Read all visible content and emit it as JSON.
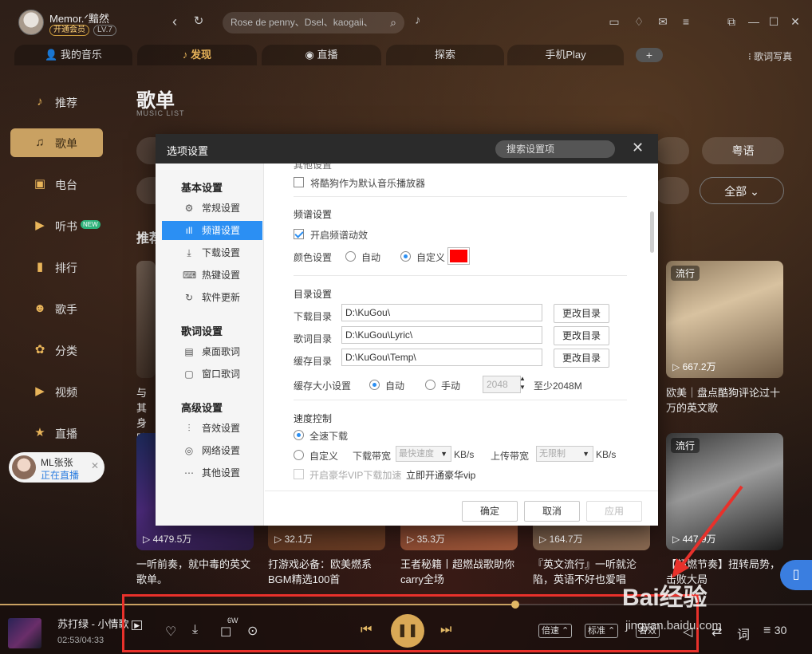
{
  "user": {
    "name": "Memor.ᐟ黯然",
    "vip": "开通会员",
    "level": "LV.7"
  },
  "search": {
    "placeholder": "Rose de penny、Dsel、kaogaii、"
  },
  "tabs": [
    {
      "label": "我的音乐"
    },
    {
      "label": "发现"
    },
    {
      "label": "直播"
    },
    {
      "label": "探索"
    },
    {
      "label": "手机Play"
    }
  ],
  "lyric_wallpaper": "歌词写真",
  "sidebar": {
    "items": [
      {
        "label": "推荐",
        "icon": "music-note-icon"
      },
      {
        "label": "歌单",
        "icon": "playlist-icon"
      },
      {
        "label": "电台",
        "icon": "radio-icon"
      },
      {
        "label": "听书",
        "icon": "book-icon",
        "badge": "NEW"
      },
      {
        "label": "排行",
        "icon": "chart-icon"
      },
      {
        "label": "歌手",
        "icon": "singer-icon"
      },
      {
        "label": "分类",
        "icon": "category-icon"
      },
      {
        "label": "视频",
        "icon": "video-icon"
      },
      {
        "label": "直播",
        "icon": "live-icon"
      }
    ],
    "live_card": {
      "name": "ML张张",
      "status": "正在直播"
    }
  },
  "page": {
    "title": "歌单",
    "subtitle": "MUSIC LIST",
    "filter_right1": "粤语",
    "filter_right2": "全部",
    "section_title_partial": "推荐"
  },
  "cards": [
    {
      "tag": "流行",
      "plays": "667.2万",
      "title": "欧美｜盘点酷狗评论过十万的英文歌"
    },
    {
      "tag": "流行",
      "plays": "447.9万",
      "title": "【超燃节奏】扭转局势，击败大局"
    },
    {
      "plays": "4479.5万",
      "title": "一听前奏，就中毒的英文歌单。"
    },
    {
      "plays": "32.1万",
      "title": "打游戏必备：欧美燃系BGM精选100首"
    },
    {
      "plays": "35.3万",
      "title": "王者秘籍丨超燃战歌助你carry全场"
    },
    {
      "plays": "164.7万",
      "title": "『英文流行』一听就沦陷，英语不好也爱唱"
    }
  ],
  "left_partial": {
    "t1": "与其",
    "t2": "身踏"
  },
  "dialog": {
    "title": "选项设置",
    "search_placeholder": "搜索设置项",
    "groups": [
      {
        "title": "基本设置",
        "items": [
          "常规设置",
          "频谱设置",
          "下载设置",
          "热键设置",
          "软件更新"
        ]
      },
      {
        "title": "歌词设置",
        "items": [
          "桌面歌词",
          "窗口歌词"
        ]
      },
      {
        "title": "高级设置",
        "items": [
          "音效设置",
          "网络设置",
          "其他设置"
        ]
      }
    ],
    "top_partial": "其他设置",
    "default_player": "将酷狗作为默认音乐播放器",
    "spectrum": {
      "title": "频谱设置",
      "enable": "开启频谱动效",
      "color_label": "颜色设置",
      "auto": "自动",
      "custom": "自定义",
      "color": "#ff0000"
    },
    "dirs": {
      "title": "目录设置",
      "rows": [
        {
          "label": "下载目录",
          "value": "D:\\KuGou\\",
          "button": "更改目录"
        },
        {
          "label": "歌词目录",
          "value": "D:\\KuGou\\Lyric\\",
          "button": "更改目录"
        },
        {
          "label": "缓存目录",
          "value": "D:\\KuGou\\Temp\\",
          "button": "更改目录"
        }
      ],
      "cache_label": "缓存大小设置",
      "cache_auto": "自动",
      "cache_manual": "手动",
      "cache_value": "2048",
      "cache_hint": "至少2048M"
    },
    "speed": {
      "title": "速度控制",
      "full": "全速下载",
      "custom": "自定义",
      "down_label": "下载带宽",
      "down_value": "最快速度",
      "unit1": "KB/s",
      "up_label": "上传带宽",
      "up_value": "无限制",
      "unit2": "KB/s",
      "vip_accel": "开启豪华VIP下载加速",
      "vip_link": "立即开通豪华vip"
    },
    "ok": "确定",
    "cancel": "取消",
    "apply": "应用"
  },
  "player": {
    "song": "苏打绿 - 小情歌",
    "time": "02:53/04:33",
    "comment_count": "6W",
    "speed": "倍速",
    "quality": "标准",
    "sound": "音效",
    "list_count": "30",
    "progress": 0.635
  },
  "watermark": {
    "brand": "Bai经验",
    "url": "jingyan.baidu.com"
  }
}
